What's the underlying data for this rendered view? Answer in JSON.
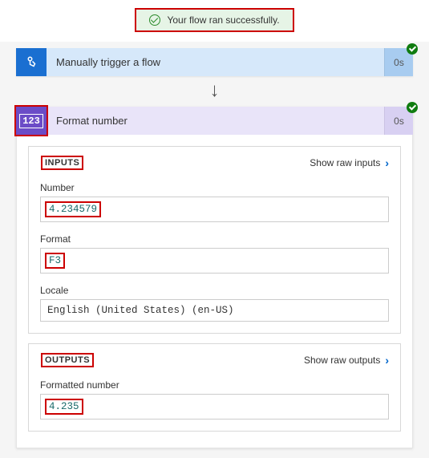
{
  "banner": {
    "message": "Your flow ran successfully."
  },
  "trigger": {
    "title": "Manually trigger a flow",
    "duration": "0s"
  },
  "action": {
    "title": "Format number",
    "duration": "0s",
    "icon_text": "123"
  },
  "inputs": {
    "section_label": "INPUTS",
    "raw_link": "Show raw inputs",
    "fields": {
      "number": {
        "label": "Number",
        "value": "4.234579"
      },
      "format": {
        "label": "Format",
        "value": "F3"
      },
      "locale": {
        "label": "Locale",
        "value": "English (United States) (en-US)"
      }
    }
  },
  "outputs": {
    "section_label": "OUTPUTS",
    "raw_link": "Show raw outputs",
    "fields": {
      "formatted": {
        "label": "Formatted number",
        "value": "4.235"
      }
    }
  }
}
